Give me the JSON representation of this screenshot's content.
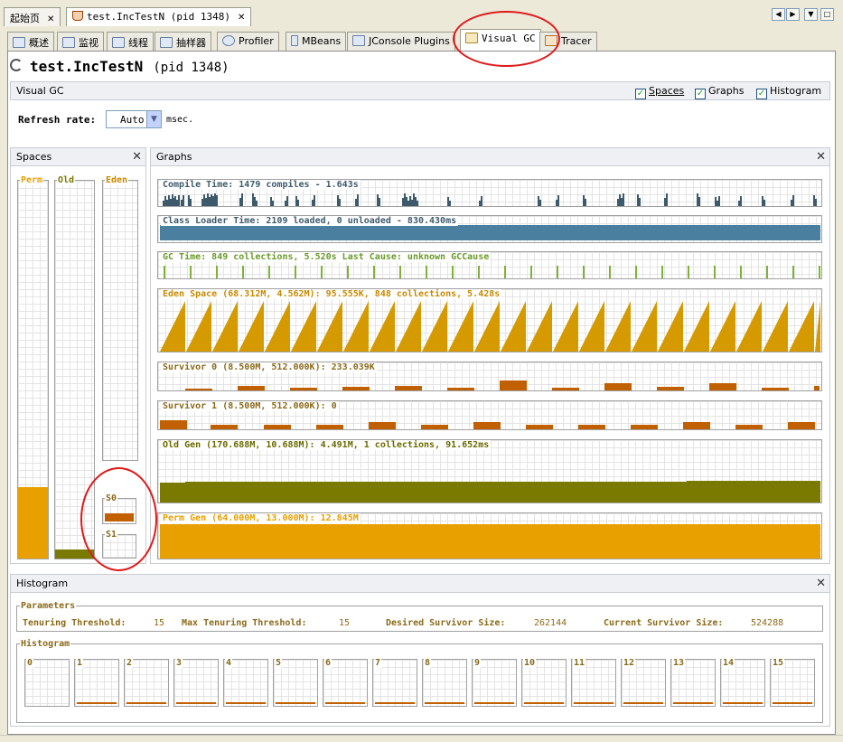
{
  "doc_tabs": [
    {
      "label": "起始页"
    },
    {
      "label": "test.IncTestN  (pid 1348)"
    }
  ],
  "tool_tabs": [
    "概述",
    "监视",
    "线程",
    "抽样器",
    "Profiler",
    "MBeans",
    "JConsole Plugins",
    "Visual GC",
    "Tracer"
  ],
  "app": {
    "title": "test.IncTestN",
    "pid": "(pid 1348)"
  },
  "visual_gc": {
    "header": "Visual GC",
    "options": {
      "spaces": "Spaces",
      "graphs": "Graphs",
      "histogram": "Histogram"
    },
    "refresh_label": "Refresh rate:",
    "refresh_value": "Auto",
    "refresh_unit": "msec."
  },
  "spaces": {
    "header": "Spaces",
    "perm": "Perm",
    "old": "Old",
    "eden": "Eden",
    "s0": "S0",
    "s1": "S1",
    "perm_fill": 0.19,
    "old_fill": 0.025,
    "s0_fill": 0.35,
    "s1_fill": 0.0
  },
  "graphs": {
    "header": "Graphs",
    "compile": "Compile Time: 1479 compiles - 1.643s",
    "classloader": "Class Loader Time: 2109 loaded, 0 unloaded - 830.430ms",
    "gc": "GC Time: 849 collections, 5.520s  Last Cause: unknown GCCause",
    "eden": "Eden Space (68.312M, 4.562M): 95.555K, 848 collections, 5.428s",
    "s0": "Survivor 0 (8.500M, 512.000K): 233.039K",
    "s1": "Survivor 1 (8.500M, 512.000K): 0",
    "old": "Old Gen (170.688M, 10.688M): 4.491M, 1 collections, 91.652ms",
    "perm": "Perm Gen (64.000M, 13.000M): 12.845M"
  },
  "histogram": {
    "header": "Histogram",
    "params_title": "Parameters",
    "tenuring_threshold_label": "Tenuring Threshold:",
    "tenuring_threshold": "15",
    "max_tenuring_threshold_label": "Max Tenuring Threshold:",
    "max_tenuring_threshold": "15",
    "desired_survivor_size_label": "Desired Survivor Size:",
    "desired_survivor_size": "262144",
    "current_survivor_size_label": "Current Survivor Size:",
    "current_survivor_size": "524288",
    "histogram_title": "Histogram",
    "buckets": [
      "0",
      "1",
      "2",
      "3",
      "4",
      "5",
      "6",
      "7",
      "8",
      "9",
      "10",
      "11",
      "12",
      "13",
      "14",
      "15"
    ]
  },
  "colors": {
    "compile": "#3d5a6c",
    "classloader": "#4a7fa0",
    "gc": "#7fb23a",
    "eden": "#d49a00",
    "survivor": "#c06000",
    "old": "#7a7a00",
    "perm": "#e8a000",
    "annotation": "#e01818"
  }
}
